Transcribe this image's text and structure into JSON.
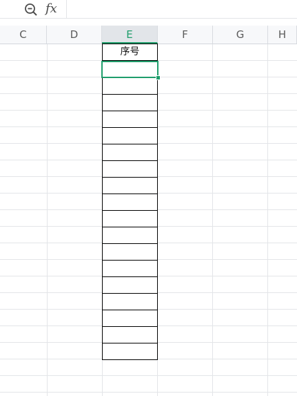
{
  "formula_bar": {
    "zoom_icon": "zoom-out-icon",
    "fx_label": "fx",
    "value": ""
  },
  "columns": [
    {
      "label": "C",
      "selected": false
    },
    {
      "label": "D",
      "selected": false
    },
    {
      "label": "E",
      "selected": true
    },
    {
      "label": "F",
      "selected": false
    },
    {
      "label": "G",
      "selected": false
    },
    {
      "label": "H",
      "selected": false
    }
  ],
  "sheet": {
    "header_cell_text": "序号",
    "active_cell": "E2",
    "accent_color": "#1f9d6b"
  }
}
